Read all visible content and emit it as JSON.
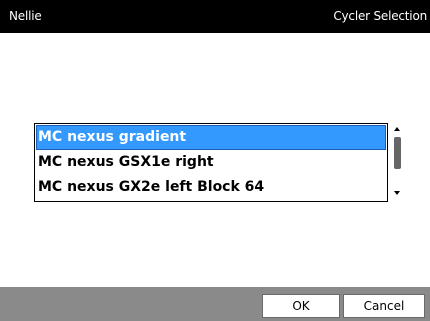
{
  "header": {
    "app_name": "Nellie",
    "screen_title": "Cycler Selection"
  },
  "cycler_list": {
    "items": [
      {
        "label": "MC nexus gradient",
        "selected": true
      },
      {
        "label": "MC nexus GSX1e right",
        "selected": false
      },
      {
        "label": "MC nexus GX2e left Block 64",
        "selected": false
      }
    ]
  },
  "footer": {
    "ok_label": "OK",
    "cancel_label": "Cancel"
  },
  "colors": {
    "selection": "#3399ff",
    "title_bar": "#000000",
    "bottom_bar": "#8a8a8a"
  },
  "icons": {
    "scroll_up": "scroll-up-arrow-icon",
    "scroll_down": "scroll-down-arrow-icon"
  }
}
